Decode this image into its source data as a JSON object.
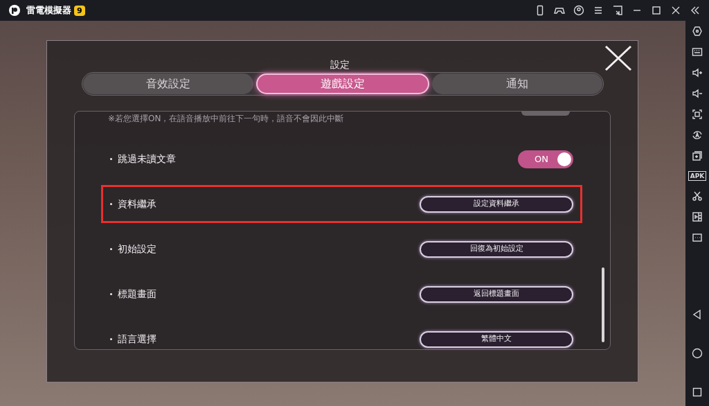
{
  "app": {
    "title": "雷電模擬器",
    "badge": "9"
  },
  "sidebar": {
    "apk_label": "APK"
  },
  "dialog": {
    "title": "設定",
    "tabs": [
      {
        "label": "音效設定",
        "selected": false
      },
      {
        "label": "遊戲設定",
        "selected": true
      },
      {
        "label": "通知",
        "selected": false
      }
    ],
    "note": "※若您選擇ON，在語音播放中前往下一句時，語音不會因此中斷",
    "rows": [
      {
        "kind": "toggle",
        "label": "跳過未讀文章",
        "on": true,
        "value": "ON",
        "highlighted": false
      },
      {
        "kind": "button",
        "label": "資料繼承",
        "button": "設定資料繼承",
        "highlighted": true
      },
      {
        "kind": "button",
        "label": "初始設定",
        "button": "回復為初始設定",
        "highlighted": false
      },
      {
        "kind": "button",
        "label": "標題畫面",
        "button": "返回標題畫面",
        "highlighted": false
      },
      {
        "kind": "button",
        "label": "語言選擇",
        "button": "繁體中文",
        "highlighted": false
      }
    ]
  }
}
